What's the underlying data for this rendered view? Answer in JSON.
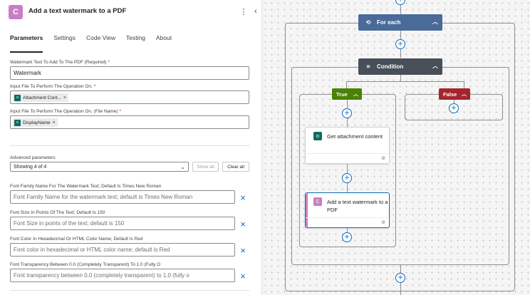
{
  "panel": {
    "icon_letter": "C",
    "title": "Add a text watermark to a PDF",
    "more_icon": "⋮",
    "collapse_icon": "‹",
    "tabs": [
      {
        "label": "Parameters"
      },
      {
        "label": "Settings"
      },
      {
        "label": "Code View"
      },
      {
        "label": "Testing"
      },
      {
        "label": "About"
      }
    ]
  },
  "fields": {
    "watermark_text": {
      "label": "Watermark Text To Add To The PDF (Required)",
      "value": "Watermark"
    },
    "input_file": {
      "label": "Input File To Perform The Operation On.",
      "token": "Attachment Cont..."
    },
    "input_file_name": {
      "label": "Input File To Perform The Operation On. (File Name)",
      "token": "DisplayName"
    }
  },
  "advanced": {
    "label": "Advanced parameters",
    "selected": "Showing 4 of 4",
    "show_all": "Show all",
    "clear_all": "Clear all"
  },
  "optional_fields": [
    {
      "label": "Font Family Name For The Watermark Text; Default Is Times New Roman",
      "placeholder": "Font Family Name for the watermark text; default is Times New Roman"
    },
    {
      "label": "Font Size In Points Of The Text; Default Is 150",
      "placeholder": "Font Size in points of the text; default is 150"
    },
    {
      "label": "Font Color In Hexadecimal Or HTML Color Name; Default Is Red",
      "placeholder": "Font color in hexadecimal or HTML color name; default is Red"
    },
    {
      "label": "Font Transparency Between 0.0 (Completely Transparent) To 1.0 (Fully O",
      "placeholder": "Font transparency between 0.0 (completely transparent) to 1.0 (fully o"
    }
  ],
  "canvas": {
    "foreach": {
      "label": "For each",
      "color": "#4a6a99"
    },
    "condition": {
      "label": "Condition",
      "color": "#484f58"
    },
    "true_branch": {
      "label": "True",
      "color": "#498205"
    },
    "false_branch": {
      "label": "False",
      "color": "#a4262c"
    },
    "cards": [
      {
        "title": "Get attachment content",
        "icon_color": "#0f6b5d"
      },
      {
        "title": "Add a text watermark to a PDF",
        "icon_color": "#c87ec4"
      }
    ]
  },
  "colors": {
    "accent": "#0f6cbd",
    "connector": "#8f8f8f"
  }
}
